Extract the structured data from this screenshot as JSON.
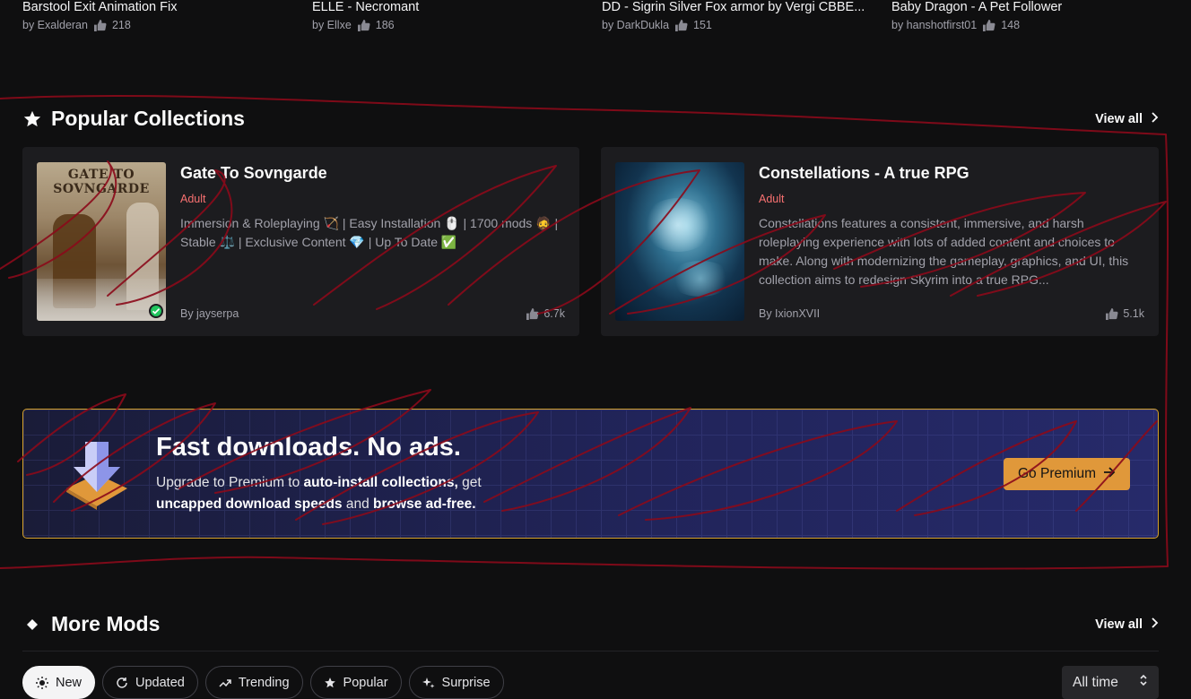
{
  "top_mods": [
    {
      "title": "Barstool Exit Animation Fix",
      "author": "by Exalderan",
      "likes": "218"
    },
    {
      "title": "ELLE - Necromant",
      "author": "by Ellxe",
      "likes": "186"
    },
    {
      "title": "DD - Sigrin Silver Fox armor by Vergi CBBE...",
      "author": "by DarkDukla",
      "likes": "151"
    },
    {
      "title": "Baby Dragon - A Pet Follower",
      "author": "by hanshotfirst01",
      "likes": "148"
    }
  ],
  "popular_collections": {
    "title": "Popular Collections",
    "view_all": "View all",
    "cards": [
      {
        "title": "Gate To Sovngarde",
        "image_caption": "GATE TO SOVNGARDE",
        "tag": "Adult",
        "description": "Immersion & Roleplaying 🏹 | Easy Installation 🖱️ | 1700 mods 🧔 | Stable ⚖️ | Exclusive Content 💎 | Up To Date ✅",
        "author": "By jayserpa",
        "likes": "6.7k"
      },
      {
        "title": "Constellations - A true RPG",
        "tag": "Adult",
        "description": "Constellations features a consistent, immersive, and harsh roleplaying experience with lots of added content and choices to make. Along with modernizing the gameplay, graphics, and UI, this collection aims to redesign Skyrim into a true RPG...",
        "author": "By IxionXVII",
        "likes": "5.1k"
      }
    ]
  },
  "premium_banner": {
    "title": "Fast downloads. No ads.",
    "line_pre": "Upgrade to Premium to ",
    "bold_1": "auto-install collections,",
    "line_mid": " get ",
    "bold_2": "uncapped download speeds",
    "line_and": " and ",
    "bold_3": "browse ad-free.",
    "button": "Go Premium"
  },
  "more_mods": {
    "title": "More Mods",
    "view_all": "View all",
    "filters": [
      {
        "label": "New",
        "icon": "sun-icon",
        "active": true
      },
      {
        "label": "Updated",
        "icon": "refresh-icon",
        "active": false
      },
      {
        "label": "Trending",
        "icon": "trending-icon",
        "active": false
      },
      {
        "label": "Popular",
        "icon": "star-icon",
        "active": false
      },
      {
        "label": "Surprise",
        "icon": "sparkle-icon",
        "active": false
      }
    ],
    "time_select": "All time"
  },
  "colors": {
    "background": "#0f0f10",
    "card": "#1c1c1f",
    "adult_tag": "#f87171",
    "premium_button": "#e0983a",
    "banner_border": "#d4a02a",
    "scribble": "#8b0a1a"
  }
}
